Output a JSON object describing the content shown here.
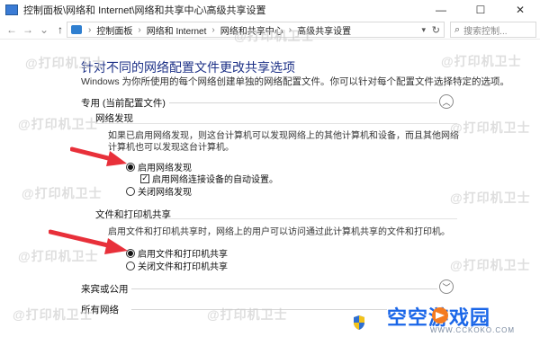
{
  "window": {
    "title": "控制面板\\网络和 Internet\\网络和共享中心\\高级共享设置",
    "minimize_glyph": "—",
    "maximize_glyph": "☐",
    "close_glyph": "✕"
  },
  "nav": {
    "back_glyph": "←",
    "forward_glyph": "→",
    "recent_glyph": "⌄",
    "up_glyph": "↑",
    "breadcrumbs": [
      "控制面板",
      "网络和 Internet",
      "网络和共享中心",
      "高级共享设置"
    ],
    "search_placeholder": "搜索控制..."
  },
  "page": {
    "heading": "针对不同的网络配置文件更改共享选项",
    "subtitle": "Windows 为你所使用的每个网络创建单独的网络配置文件。你可以针对每个配置文件选择特定的选项。"
  },
  "profiles": [
    {
      "label": "专用 (当前配置文件)",
      "expanded": true,
      "chevron": "︿",
      "groups": [
        {
          "title": "网络发现",
          "description": "如果已启用网络发现，则这台计算机可以发现网络上的其他计算机和设备，而且其他网络计算机也可以发现这台计算机。",
          "options": [
            {
              "type": "radio",
              "label": "启用网络发现",
              "selected": true
            },
            {
              "type": "checkbox",
              "label": "启用网络连接设备的自动设置。",
              "checked": true
            },
            {
              "type": "radio",
              "label": "关闭网络发现",
              "selected": false
            }
          ]
        },
        {
          "title": "文件和打印机共享",
          "description": "启用文件和打印机共享时，网络上的用户可以访问通过此计算机共享的文件和打印机。",
          "options": [
            {
              "type": "radio",
              "label": "启用文件和打印机共享",
              "selected": true
            },
            {
              "type": "radio",
              "label": "关闭文件和打印机共享",
              "selected": false
            }
          ]
        }
      ]
    },
    {
      "label": "来宾或公用",
      "expanded": false,
      "chevron": "﹀"
    },
    {
      "label": "所有网络",
      "expanded": false,
      "chevron": "﹀"
    }
  ],
  "watermark": "@打印机卫士",
  "brand": {
    "name": "空空游戏园",
    "url": "WWW.CCKOKO.COM"
  },
  "colors": {
    "heading": "#1e3287",
    "arrow": "#e8303a",
    "brand": "#1a66e8"
  }
}
